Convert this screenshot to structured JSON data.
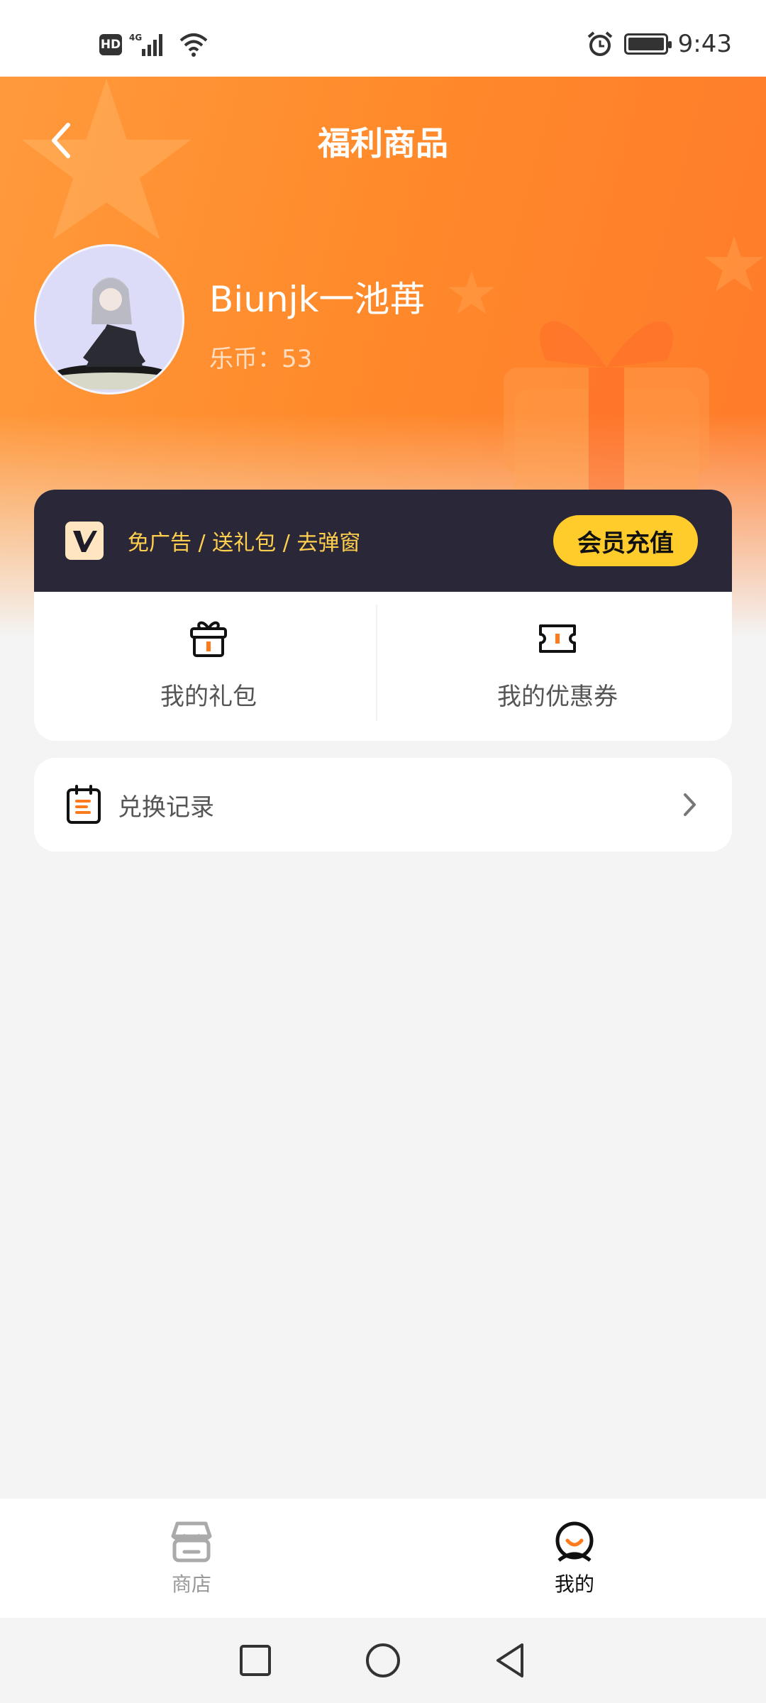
{
  "status_bar": {
    "hd": "HD",
    "network": "4G",
    "time": "9:43"
  },
  "header": {
    "title": "福利商品"
  },
  "profile": {
    "username": "Biunjk一池苒",
    "coins_label": "乐币：",
    "coins_value": "53"
  },
  "vip": {
    "benefits": "免广告 / 送礼包 / 去弹窗",
    "button_label": "会员充值",
    "accent_color": "#ffcc2c"
  },
  "quick_actions": [
    {
      "label": "我的礼包",
      "icon": "gift-icon"
    },
    {
      "label": "我的优惠券",
      "icon": "coupon-icon"
    }
  ],
  "exchange_record": {
    "label": "兑换记录",
    "icon": "clipboard-icon"
  },
  "tab_bar": {
    "items": [
      {
        "label": "商店",
        "icon": "store-icon",
        "active": false
      },
      {
        "label": "我的",
        "icon": "profile-icon",
        "active": true
      }
    ]
  },
  "colors": {
    "brand_orange": "#ff8a2b",
    "vip_bar": "#2a2838"
  }
}
